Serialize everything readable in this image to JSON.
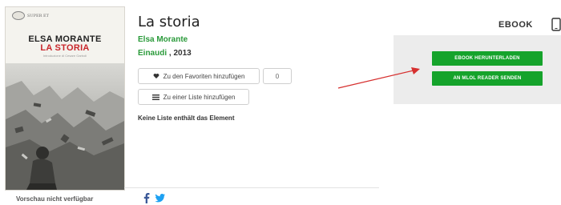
{
  "book": {
    "title": "La storia",
    "author": "Elsa Morante",
    "publisher": "Einaudi",
    "year_suffix": " , 2013"
  },
  "cover": {
    "series_logo": "SUPER ET",
    "author": "ELSA MORANTE",
    "title": "LA STORIA",
    "intro": "Introduzione di Cesare Garboli"
  },
  "actions": {
    "favorites_label": "Zu den Favoriten hinzufügen",
    "favorites_count": "0",
    "list_label": "Zu einer Liste hinzufügen",
    "no_list_text": "Keine Liste enthält das Element"
  },
  "footer": {
    "preview_note": "Vorschau nicht verfügbar"
  },
  "ebook": {
    "format_label": "EBOOK",
    "download_label": "EBOOK HERUNTERLADEN",
    "send_label": "AN MLOL READER SENDEN"
  },
  "colors": {
    "accent_green": "#15a32b",
    "link_green": "#2a9a3a",
    "cover_title_red": "#c8262b",
    "annotation_arrow": "#d6302f",
    "facebook_blue": "#3b5998",
    "twitter_blue": "#1da1f2",
    "panel_gray": "#ececec"
  },
  "icons": [
    "heart-icon",
    "list-icon",
    "facebook-icon",
    "twitter-icon",
    "tablet-icon",
    "arrow-annotation"
  ]
}
